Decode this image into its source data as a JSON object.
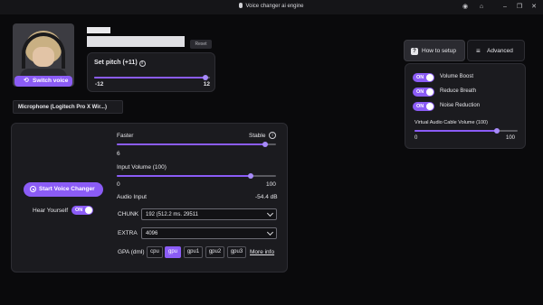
{
  "window": {
    "title": "Voice changer ai engine"
  },
  "profile": {
    "switch_voice_label": "Switch voice",
    "reset_label": "Reset"
  },
  "pitch": {
    "label": "Set pitch (+11)",
    "min_label": "-12",
    "max_label": "12",
    "value": 11,
    "min": -12,
    "max": 12
  },
  "microphone": {
    "selected": "Microphone (Logitech Pro X Wir...)"
  },
  "engine": {
    "speed": {
      "left_label": "Faster",
      "right_label": "Stable",
      "value_label": "6",
      "fraction": 0.93
    },
    "input_volume": {
      "label": "Input Volume (100)",
      "min_label": "0",
      "max_label": "100",
      "value": 100,
      "fraction": 0.84
    },
    "audio_input": {
      "label": "Audio Input",
      "value": "-54.4 dB"
    },
    "chunk": {
      "label": "CHUNK",
      "value": "192 (512.2 ms. 29511"
    },
    "extra": {
      "label": "EXTRA",
      "value": "4096"
    },
    "gpu": {
      "label": "GPA (dml)",
      "options": [
        "cpu",
        "gpu",
        "gpu1",
        "gpu2",
        "gpu3"
      ],
      "selected": "gpu",
      "more_info": "More info"
    },
    "start_label": "Start Voice Changer",
    "hear_yourself": {
      "label": "Hear Yourself",
      "state": "ON"
    }
  },
  "tabs": {
    "how_to_setup": "How to setup",
    "advanced": "Advanced"
  },
  "advanced": {
    "toggles": [
      {
        "state": "ON",
        "label": "Volume Boost"
      },
      {
        "state": "ON",
        "label": "Reduce Breath"
      },
      {
        "state": "ON",
        "label": "Noise Reduction"
      }
    ],
    "cable_volume": {
      "label": "Virtual Audio Cable Volume (100)",
      "min_label": "0",
      "max_label": "100",
      "value": 100,
      "fraction": 0.8
    }
  },
  "colors": {
    "accent": "#8b5cf6",
    "panel": "#1b1b1f",
    "background": "#0a0a0c"
  }
}
